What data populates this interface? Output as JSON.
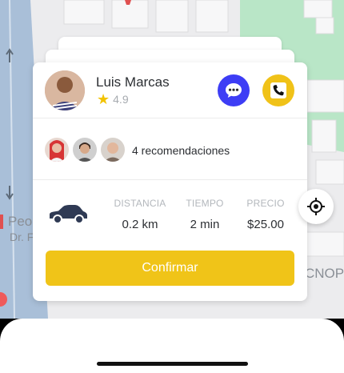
{
  "driver": {
    "name": "Luis Marcas",
    "rating": "4.9"
  },
  "actions": {
    "chat_icon": "chat-bubble-icon",
    "call_icon": "phone-icon"
  },
  "recommendations": {
    "text": "4 recomendaciones"
  },
  "trip": {
    "vehicle_icon": "car-icon",
    "stats": [
      {
        "label": "DISTANCIA",
        "value": "0.2 km"
      },
      {
        "label": "TIEMPO",
        "value": "2 min"
      },
      {
        "label": "PRECIO",
        "value": "$25.00"
      }
    ]
  },
  "confirm_label": "Confirmar",
  "map": {
    "labels": {
      "street_left_1": "Peo",
      "street_left_2": "Dr. F",
      "street_right": "CNOP"
    }
  },
  "colors": {
    "accent_yellow": "#f0c418",
    "chat_blue": "#3d3df5",
    "star": "#f2c300",
    "map_green": "#b9e6c7"
  }
}
